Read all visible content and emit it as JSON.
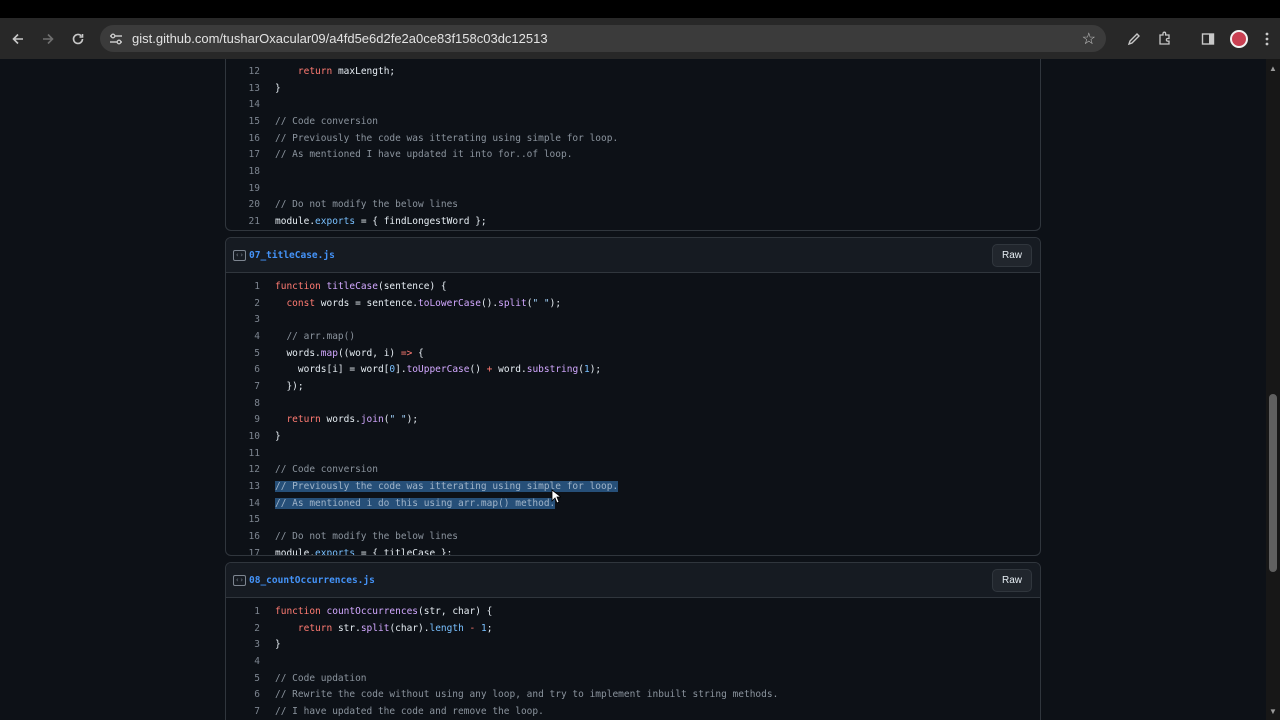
{
  "browser": {
    "url": "gist.github.com/tusharOxacular09/a4fd5e6d2fe2a0ce83f158c03dc12513"
  },
  "files": [
    {
      "name": "",
      "lines": [
        {
          "n": "12",
          "html": "    <span class='kw'>return</span> maxLength;"
        },
        {
          "n": "13",
          "html": "}"
        },
        {
          "n": "14",
          "html": ""
        },
        {
          "n": "15",
          "html": "<span class='cm'>// Code conversion</span>"
        },
        {
          "n": "16",
          "html": "<span class='cm'>// Previously the code was itterating using simple for loop.</span>"
        },
        {
          "n": "17",
          "html": "<span class='cm'>// As mentioned I have updated it into for..of loop.</span>"
        },
        {
          "n": "18",
          "html": ""
        },
        {
          "n": "19",
          "html": ""
        },
        {
          "n": "20",
          "html": "<span class='cm'>// Do not modify the below lines</span>"
        },
        {
          "n": "21",
          "html": "module.<span class='pr'>exports</span> = { findLongestWord };"
        }
      ]
    },
    {
      "name": "07_titleCase.js",
      "raw": "Raw",
      "lines": [
        {
          "n": "1",
          "html": "<span class='kw'>function</span> <span class='fn'>titleCase</span>(sentence) {"
        },
        {
          "n": "2",
          "html": "  <span class='kw'>const</span> words = sentence.<span class='fn'>toLowerCase</span>().<span class='fn'>split</span>(<span class='st'>\" \"</span>);"
        },
        {
          "n": "3",
          "html": ""
        },
        {
          "n": "4",
          "html": "  <span class='cm'>// arr.map()</span>"
        },
        {
          "n": "5",
          "html": "  words.<span class='fn'>map</span>((word, i) <span class='kw'>=&gt;</span> {"
        },
        {
          "n": "6",
          "html": "    words[i] = word[<span class='pr'>0</span>].<span class='fn'>toUpperCase</span>() <span class='kw'>+</span> word.<span class='fn'>substring</span>(<span class='pr'>1</span>);"
        },
        {
          "n": "7",
          "html": "  });"
        },
        {
          "n": "8",
          "html": ""
        },
        {
          "n": "9",
          "html": "  <span class='kw'>return</span> words.<span class='fn'>join</span>(<span class='st'>\" \"</span>);"
        },
        {
          "n": "10",
          "html": "}"
        },
        {
          "n": "11",
          "html": ""
        },
        {
          "n": "12",
          "html": "<span class='cm'>// Code conversion</span>"
        },
        {
          "n": "13",
          "html": "<span class='sel'>// Previously the code was itterating using simple for loop.</span>"
        },
        {
          "n": "14",
          "html": "<span class='sel'>// As mentioned i do this using arr.map() method.</span>"
        },
        {
          "n": "15",
          "html": ""
        },
        {
          "n": "16",
          "html": "<span class='cm'>// Do not modify the below lines</span>"
        },
        {
          "n": "17",
          "html": "module.<span class='pr'>exports</span> = { titleCase };"
        }
      ]
    },
    {
      "name": "08_countOccurrences.js",
      "raw": "Raw",
      "lines": [
        {
          "n": "1",
          "html": "<span class='kw'>function</span> <span class='fn'>countOccurrences</span>(str, char) {"
        },
        {
          "n": "2",
          "html": "    <span class='kw'>return</span> str.<span class='fn'>split</span>(char).<span class='pr'>length</span> <span class='kw'>-</span> <span class='pr'>1</span>;"
        },
        {
          "n": "3",
          "html": "}"
        },
        {
          "n": "4",
          "html": ""
        },
        {
          "n": "5",
          "html": "<span class='cm'>// Code updation</span>"
        },
        {
          "n": "6",
          "html": "<span class='cm'>// Rewrite the code without using any loop, and try to implement inbuilt string methods.</span>"
        },
        {
          "n": "7",
          "html": "<span class='cm'>// I have updated the code and remove the loop.</span>"
        }
      ]
    }
  ]
}
